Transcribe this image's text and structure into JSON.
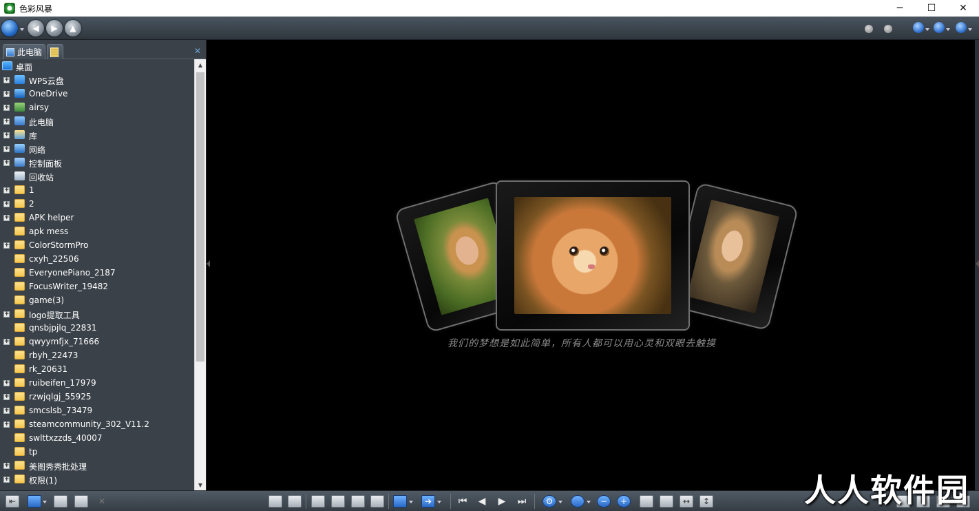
{
  "window": {
    "title": "色彩风暴",
    "minimize": "─",
    "maximize": "☐",
    "close": "✕"
  },
  "navbar": {
    "back": "◀",
    "forward": "▶",
    "up": "▲"
  },
  "left_panel": {
    "tabs": [
      {
        "label": "此电脑",
        "icon": "computer-icon"
      },
      {
        "label": "",
        "icon": "zip-folder-icon"
      }
    ],
    "close_glyph": "✕",
    "tree": [
      {
        "label": "桌面",
        "icon": "desktop-icon",
        "expandable": false,
        "root": true
      },
      {
        "label": "WPS云盘",
        "icon": "wps-cloud-icon",
        "expandable": true
      },
      {
        "label": "OneDrive",
        "icon": "onedrive-icon",
        "expandable": true
      },
      {
        "label": "airsy",
        "icon": "user-icon",
        "expandable": true
      },
      {
        "label": "此电脑",
        "icon": "computer-icon",
        "expandable": true
      },
      {
        "label": "库",
        "icon": "library-icon",
        "expandable": true
      },
      {
        "label": "网络",
        "icon": "network-icon",
        "expandable": true
      },
      {
        "label": "控制面板",
        "icon": "control-panel-icon",
        "expandable": true
      },
      {
        "label": "回收站",
        "icon": "recycle-bin-icon",
        "expandable": false
      },
      {
        "label": "1",
        "icon": "folder-icon",
        "expandable": true
      },
      {
        "label": "2",
        "icon": "folder-icon",
        "expandable": true
      },
      {
        "label": "APK helper",
        "icon": "folder-icon",
        "expandable": true
      },
      {
        "label": "apk mess",
        "icon": "folder-icon",
        "expandable": false
      },
      {
        "label": "ColorStormPro",
        "icon": "folder-icon",
        "expandable": true
      },
      {
        "label": "cxyh_22506",
        "icon": "folder-icon",
        "expandable": false
      },
      {
        "label": "EveryonePiano_2187",
        "icon": "folder-icon",
        "expandable": false
      },
      {
        "label": "FocusWriter_19482",
        "icon": "folder-icon",
        "expandable": false
      },
      {
        "label": "game(3)",
        "icon": "folder-icon",
        "expandable": false
      },
      {
        "label": "logo提取工具",
        "icon": "folder-icon",
        "expandable": true
      },
      {
        "label": "qnsbjpjlq_22831",
        "icon": "folder-icon",
        "expandable": false
      },
      {
        "label": "qwyymfjx_71666",
        "icon": "folder-icon",
        "expandable": true
      },
      {
        "label": "rbyh_22473",
        "icon": "folder-icon",
        "expandable": false
      },
      {
        "label": "rk_20631",
        "icon": "folder-icon",
        "expandable": false
      },
      {
        "label": "ruibeifen_17979",
        "icon": "folder-icon",
        "expandable": true
      },
      {
        "label": "rzwjqlgj_55925",
        "icon": "folder-icon",
        "expandable": true
      },
      {
        "label": "smcslsb_73479",
        "icon": "folder-icon",
        "expandable": true
      },
      {
        "label": "steamcommunity_302_V11.2",
        "icon": "folder-icon",
        "expandable": true
      },
      {
        "label": "swlttxzzds_40007",
        "icon": "folder-icon",
        "expandable": false
      },
      {
        "label": "tp",
        "icon": "folder-icon",
        "expandable": false
      },
      {
        "label": "美图秀秀批处理",
        "icon": "folder-icon",
        "expandable": true
      },
      {
        "label": "权限(1)",
        "icon": "folder-icon",
        "expandable": true
      }
    ]
  },
  "viewer": {
    "caption": "我们的梦想是如此简单，所有人都可以用心灵和双眼去触摸",
    "images": [
      "girl-photo",
      "kitten-photo",
      "woman-photo"
    ]
  },
  "bottom_toolbar": {
    "first": "⏮",
    "prev": "◀",
    "next": "▶",
    "last": "⏭"
  },
  "watermark": "人人软件园",
  "colors": {
    "toolbar_top": "#4a5560",
    "toolbar_bottom": "#2f363d",
    "panel_bg": "#3a4148",
    "viewer_bg": "#000000",
    "folder": "#f5c750",
    "accent_blue": "#2369c6"
  }
}
